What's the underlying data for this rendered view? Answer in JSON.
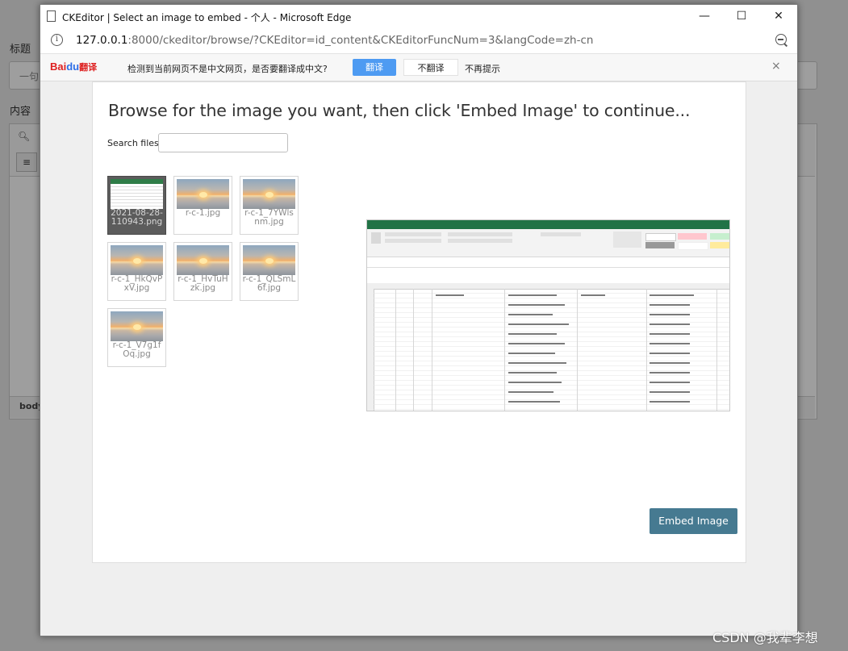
{
  "background_page": {
    "title_label": "标题",
    "title_input_value": "一句",
    "content_label": "内容",
    "status_path": "body"
  },
  "window": {
    "title": "CKEditor | Select an image to embed - 个人 - Microsoft Edge",
    "controls": {
      "minimize": "—",
      "maximize": "☐",
      "close": "✕"
    }
  },
  "address_bar": {
    "url_host": "127.0.0.1",
    "url_rest": ":8000/ckeditor/browse/?CKEditor=id_content&CKEditorFuncNum=3&langCode=zh-cn"
  },
  "translate_bar": {
    "logo_part1": "Bai",
    "logo_part2": "du",
    "logo_part3": "翻译",
    "message": "检测到当前网页不是中文网页，是否要翻译成中文?",
    "translate_button": "翻译",
    "no_translate_button": "不翻译",
    "never_link": "不再提示",
    "close": "×"
  },
  "browser": {
    "heading": "Browse for the image you want, then click 'Embed Image' to continue...",
    "search_label": "Search files:",
    "search_value": "",
    "thumbnails": [
      {
        "caption": "2021-08-28-110943.png",
        "selected": true
      },
      {
        "caption": "r-c-1.jpg",
        "selected": false
      },
      {
        "caption": "r-c-1_7YWlsnm.jpg",
        "selected": false
      },
      {
        "caption": "r-c-1_HkQvPxV.jpg",
        "selected": false
      },
      {
        "caption": "r-c-1_HvTuHzk.jpg",
        "selected": false
      },
      {
        "caption": "r-c-1_QLSmL6f.jpg",
        "selected": false
      },
      {
        "caption": "r-c-1_V7g1fOq.jpg",
        "selected": false
      }
    ],
    "embed_button": "Embed Image"
  },
  "watermark": "CSDN @我辈李想",
  "colors": {
    "embed_button": "#467a91",
    "translate_button": "#4e9bf2",
    "excel_green": "#217346"
  }
}
